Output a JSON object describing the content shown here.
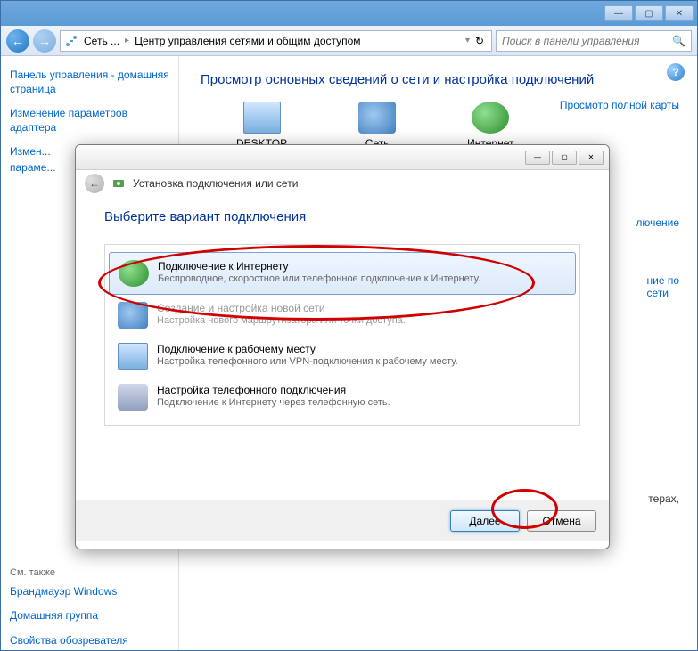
{
  "titlebar": {
    "min": "—",
    "max": "▢",
    "close": "✕"
  },
  "nav": {
    "back": "←",
    "fwd": "→",
    "sep": "▸"
  },
  "breadcrumb": {
    "items": [
      "Сеть ...",
      "Центр управления сетями и общим доступом"
    ]
  },
  "search": {
    "placeholder": "Поиск в панели управления"
  },
  "sidebar": {
    "links": [
      "Панель управления - домашняя страница",
      "Изменение параметров адаптера",
      "Измен...",
      "параме..."
    ],
    "also_label": "См. также",
    "footer": [
      "Брандмауэр Windows",
      "Домашняя группа",
      "Свойства обозревателя"
    ]
  },
  "main": {
    "heading": "Просмотр основных сведений о сети и настройка подключений",
    "map_link": "Просмотр полной карты",
    "nodes": [
      "DESKTOP",
      "Сеть",
      "Интернет"
    ],
    "partial_a": "лючение",
    "partial_b1": "ние по",
    "partial_b2": "сети",
    "partial_c": "терах,"
  },
  "wizard": {
    "winbtns": {
      "min": "—",
      "max": "▢",
      "close": "✕"
    },
    "back": "←",
    "title": "Установка подключения или сети",
    "heading": "Выберите вариант подключения",
    "options": [
      {
        "title": "Подключение к Интернету",
        "desc": "Беспроводное, скоростное или телефонное подключение к Интернету.",
        "selected": true
      },
      {
        "title": "Создание и настройка новой сети",
        "desc": "Настройка нового маршрутизатора или точки доступа.",
        "disabled": true
      },
      {
        "title": "Подключение к рабочему месту",
        "desc": "Настройка телефонного или VPN-подключения к рабочему месту."
      },
      {
        "title": "Настройка телефонного подключения",
        "desc": "Подключение к Интернету через телефонную сеть."
      }
    ],
    "btn_next": "Далее",
    "btn_cancel": "Отмена"
  }
}
